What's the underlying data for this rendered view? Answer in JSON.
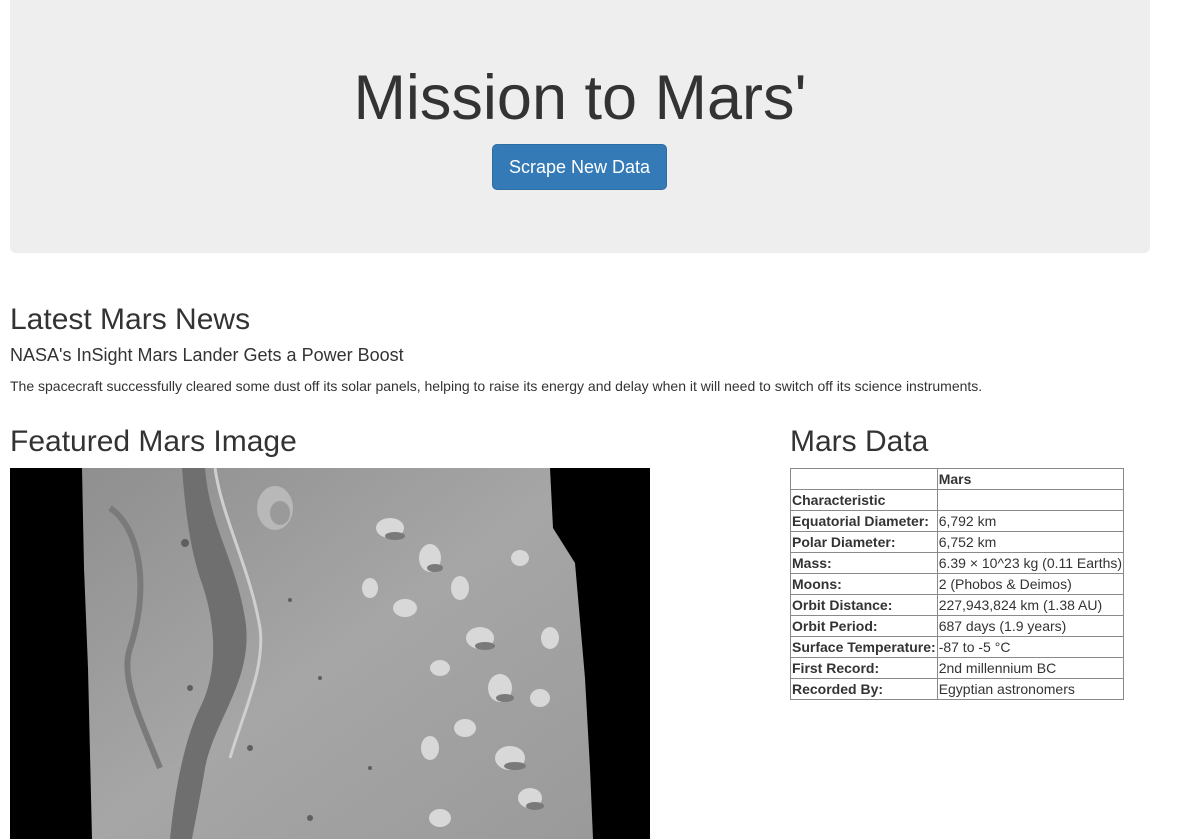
{
  "header": {
    "title": "Mission to Mars'",
    "scrape_button_label": "Scrape New Data"
  },
  "news": {
    "heading": "Latest Mars News",
    "title": "NASA's InSight Mars Lander Gets a Power Boost",
    "teaser": "The spacecraft successfully cleared some dust off its solar panels, helping to raise its energy and delay when it will need to switch off its science instruments."
  },
  "featured": {
    "heading": "Featured Mars Image"
  },
  "mars_data": {
    "heading": "Mars Data",
    "column_header": "Mars",
    "index_label": "Characteristic",
    "rows": [
      {
        "label": "Equatorial Diameter:",
        "value": "6,792 km"
      },
      {
        "label": "Polar Diameter:",
        "value": "6,752 km"
      },
      {
        "label": "Mass:",
        "value": "6.39 × 10^23 kg (0.11 Earths)"
      },
      {
        "label": "Moons:",
        "value": "2 (Phobos & Deimos)"
      },
      {
        "label": "Orbit Distance:",
        "value": "227,943,824 km (1.38 AU)"
      },
      {
        "label": "Orbit Period:",
        "value": "687 days (1.9 years)"
      },
      {
        "label": "Surface Temperature:",
        "value": "-87 to -5 °C"
      },
      {
        "label": "First Record:",
        "value": "2nd millennium BC"
      },
      {
        "label": "Recorded By:",
        "value": "Egyptian astronomers"
      }
    ]
  },
  "colors": {
    "jumbotron_bg": "#eeeeee",
    "primary_button": "#337ab7",
    "text": "#333333"
  }
}
